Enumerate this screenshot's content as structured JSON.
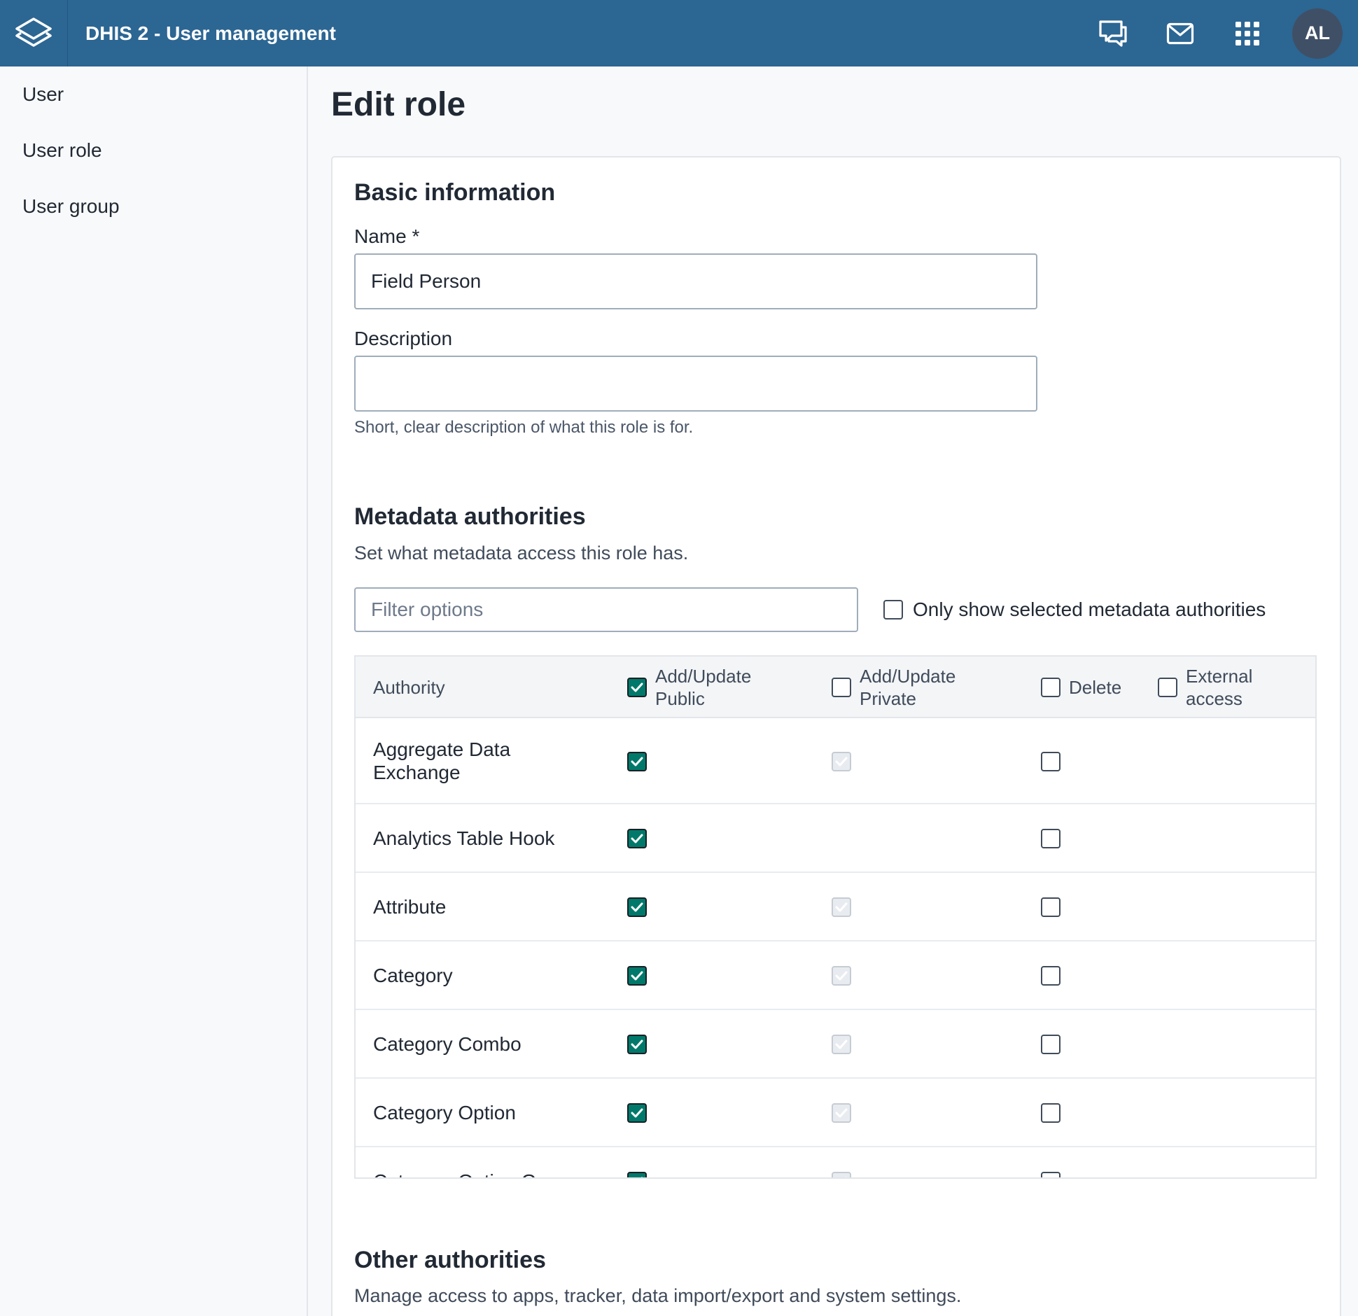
{
  "header": {
    "app_title": "DHIS 2 - User management",
    "logo_icon": "dhis2-logo-icon",
    "icons": [
      "interpretations-icon",
      "messages-icon",
      "apps-grid-icon"
    ],
    "avatar_initials": "AL",
    "bg_color": "#2c6693"
  },
  "sidebar": {
    "items": [
      {
        "label": "User"
      },
      {
        "label": "User role"
      },
      {
        "label": "User group"
      }
    ]
  },
  "page": {
    "title": "Edit role"
  },
  "basic": {
    "heading": "Basic information",
    "name_label": "Name *",
    "name_value": "Field Person",
    "description_label": "Description",
    "description_value": "",
    "description_help": "Short, clear description of what this role is for."
  },
  "metadata": {
    "heading": "Metadata authorities",
    "subtext": "Set what metadata access this role has.",
    "filter_placeholder": "Filter options",
    "only_show_label": "Only show selected metadata authorities",
    "only_show_checked": false,
    "columns": {
      "authority": "Authority",
      "public_line1": "Add/Update",
      "public_line2": "Public",
      "public_checked": true,
      "private_line1": "Add/Update",
      "private_line2": "Private",
      "private_checked": false,
      "delete": "Delete",
      "delete_checked": false,
      "external_line1": "External",
      "external_line2": "access",
      "external_checked": false
    },
    "rows": [
      {
        "name": "Aggregate Data Exchange",
        "public": "checked",
        "private": "disabled",
        "delete": "unchecked"
      },
      {
        "name": "Analytics Table Hook",
        "public": "checked",
        "private": "none",
        "delete": "unchecked"
      },
      {
        "name": "Attribute",
        "public": "checked",
        "private": "disabled",
        "delete": "unchecked"
      },
      {
        "name": "Category",
        "public": "checked",
        "private": "disabled",
        "delete": "unchecked"
      },
      {
        "name": "Category Combo",
        "public": "checked",
        "private": "disabled",
        "delete": "unchecked"
      },
      {
        "name": "Category Option",
        "public": "checked",
        "private": "disabled",
        "delete": "unchecked"
      },
      {
        "name": "Category Option Group",
        "public": "checked",
        "private": "disabled",
        "delete": "unchecked"
      }
    ],
    "accent_color": "#00796b"
  },
  "other": {
    "heading": "Other authorities",
    "subtext": "Manage access to apps, tracker, data import/export and system settings."
  }
}
